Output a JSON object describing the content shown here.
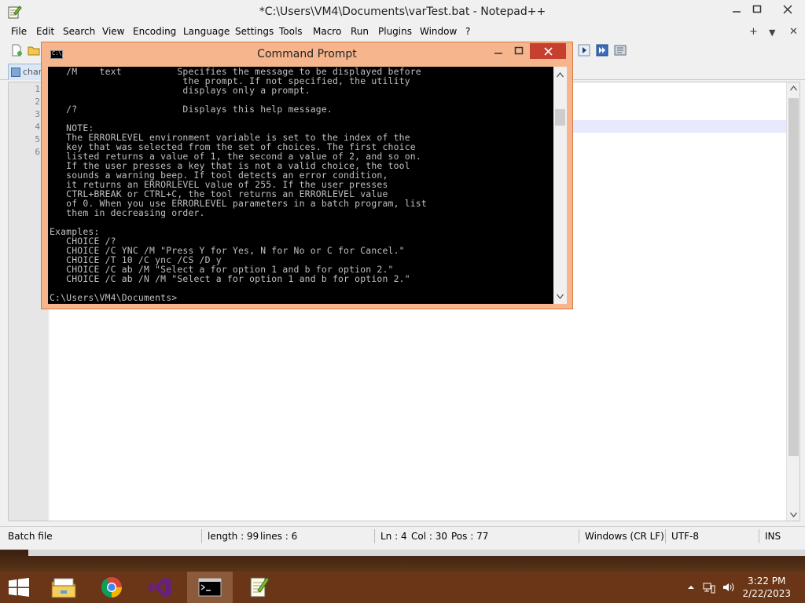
{
  "notepad": {
    "title": "*C:\\Users\\VM4\\Documents\\varTest.bat - Notepad++",
    "menu": [
      "File",
      "Edit",
      "Search",
      "View",
      "Encoding",
      "Language",
      "Settings",
      "Tools",
      "Macro",
      "Run",
      "Plugins",
      "Window",
      "?"
    ],
    "menu_right": [
      "+",
      "▼",
      "✕"
    ],
    "tab_label": "chan",
    "line_numbers": [
      "1",
      "2",
      "3",
      "4",
      "5",
      "6"
    ],
    "status": {
      "file_type": "Batch file",
      "length": "length : 99",
      "lines": "lines : 6",
      "ln": "Ln : 4",
      "col": "Col : 30",
      "pos": "Pos : 77",
      "eol": "Windows (CR LF)",
      "encoding": "UTF-8",
      "mode": "INS"
    }
  },
  "cmd": {
    "title": "Command Prompt",
    "icon_text": "C:\\_",
    "lines": [
      "   /M    text          Specifies the message to be displayed before",
      "                        the prompt. If not specified, the utility",
      "                        displays only a prompt.",
      "",
      "   /?                   Displays this help message.",
      "",
      "   NOTE:",
      "   The ERRORLEVEL environment variable is set to the index of the",
      "   key that was selected from the set of choices. The first choice",
      "   listed returns a value of 1, the second a value of 2, and so on.",
      "   If the user presses a key that is not a valid choice, the tool",
      "   sounds a warning beep. If tool detects an error condition,",
      "   it returns an ERRORLEVEL value of 255. If the user presses",
      "   CTRL+BREAK or CTRL+C, the tool returns an ERRORLEVEL value",
      "   of 0. When you use ERRORLEVEL parameters in a batch program, list",
      "   them in decreasing order.",
      "",
      "Examples:",
      "   CHOICE /?",
      "   CHOICE /C YNC /M \"Press Y for Yes, N for No or C for Cancel.\"",
      "   CHOICE /T 10 /C ync /CS /D y",
      "   CHOICE /C ab /M \"Select a for option 1 and b for option 2.\"",
      "   CHOICE /C ab /N /M \"Select a for option 1 and b for option 2.\"",
      "",
      "C:\\Users\\VM4\\Documents>"
    ]
  },
  "taskbar": {
    "apps": [
      "file-explorer",
      "chrome",
      "visual-studio",
      "command-prompt",
      "notepad-plus-plus"
    ],
    "time": "3:22 PM",
    "date": "2/22/2023"
  }
}
